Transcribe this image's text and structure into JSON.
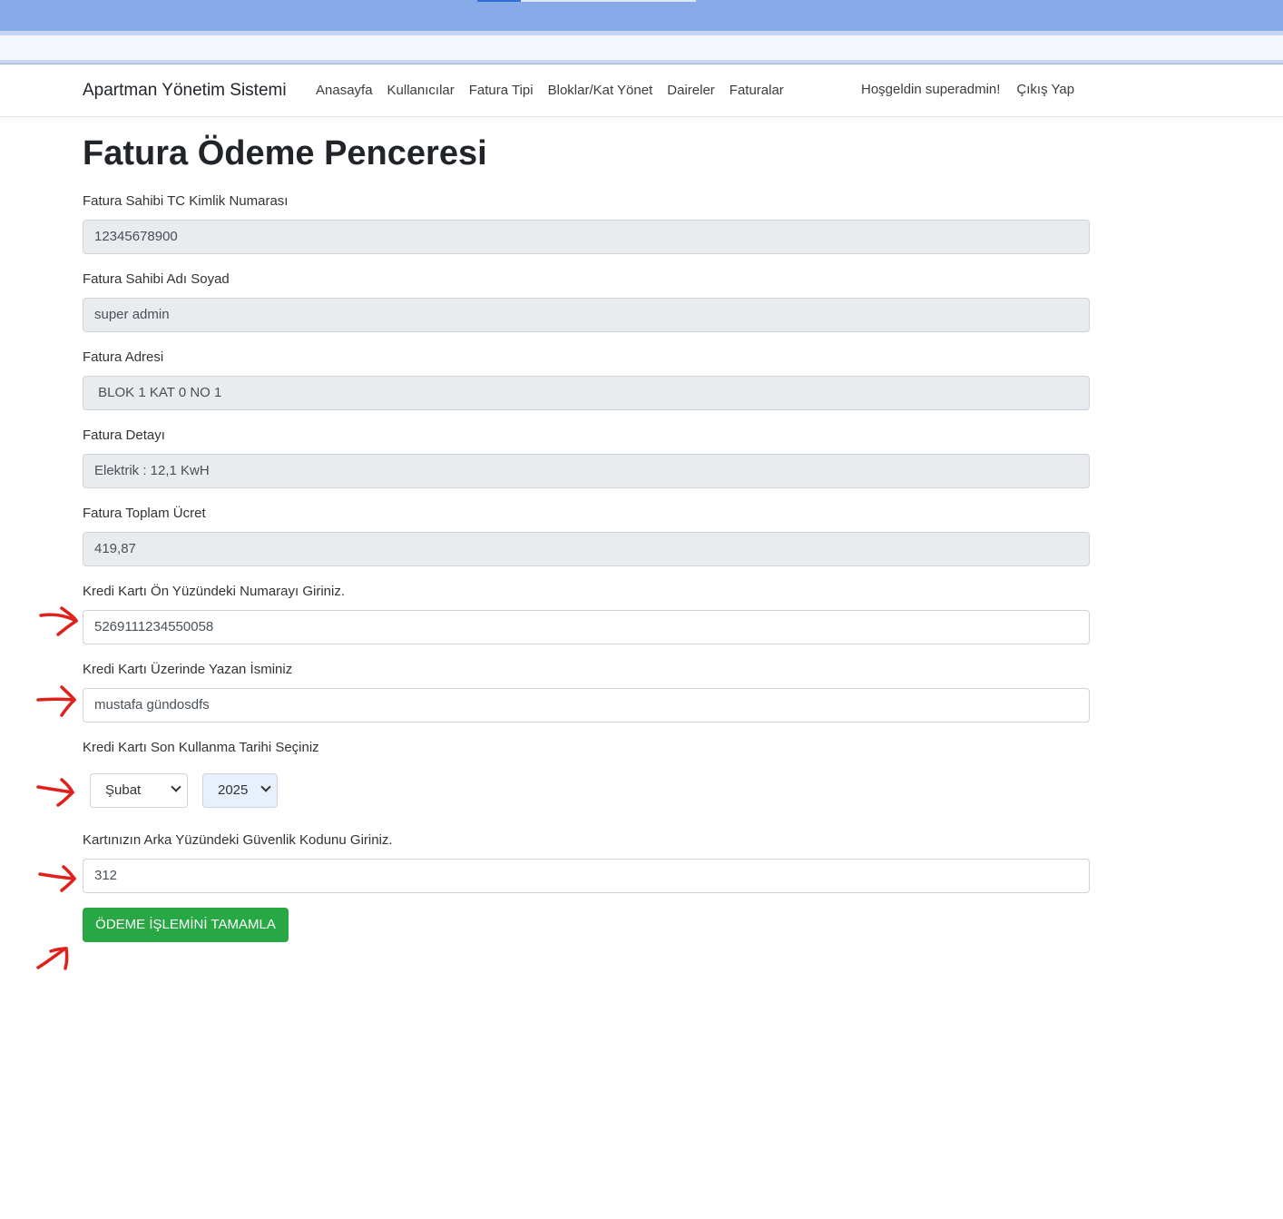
{
  "navbar": {
    "brand": "Apartman Yönetim Sistemi",
    "links": [
      "Anasayfa",
      "Kullanıcılar",
      "Fatura Tipi",
      "Bloklar/Kat Yönet",
      "Daireler",
      "Faturalar"
    ],
    "welcome": "Hoşgeldin superadmin!",
    "logout": "Çıkış Yap"
  },
  "page": {
    "title": "Fatura Ödeme Penceresi"
  },
  "form": {
    "tc_label": "Fatura Sahibi TC Kimlik Numarası",
    "tc_value": "12345678900",
    "name_label": "Fatura Sahibi Adı Soyad",
    "name_value": "super admin",
    "address_label": "Fatura Adresi",
    "address_value": " BLOK 1 KAT 0 NO 1",
    "detail_label": "Fatura Detayı",
    "detail_value": "Elektrik : 12,1 KwH",
    "total_label": "Fatura Toplam Ücret",
    "total_value": "419,87",
    "card_number_label": "Kredi Kartı Ön Yüzündeki Numarayı Giriniz.",
    "card_number_value": "5269111234550058",
    "card_name_label": "Kredi Kartı Üzerinde Yazan İsminiz",
    "card_name_value": "mustafa gündosdfs",
    "expiry_label": "Kredi Kartı Son Kullanma Tarihi Seçiniz",
    "expiry_month": "Şubat",
    "expiry_year": "2025",
    "cvv_label": "Kartınızın Arka Yüzündeki Güvenlik Kodunu Giriniz.",
    "cvv_value": "312",
    "submit_label": "ÖDEME İŞLEMİNİ TAMAMLA"
  },
  "annotations": {
    "arrow_color": "#e0201b"
  },
  "colors": {
    "accent_green": "#28a745",
    "readonly_bg": "#e9ecef",
    "browser_blue": "#86abe8"
  }
}
